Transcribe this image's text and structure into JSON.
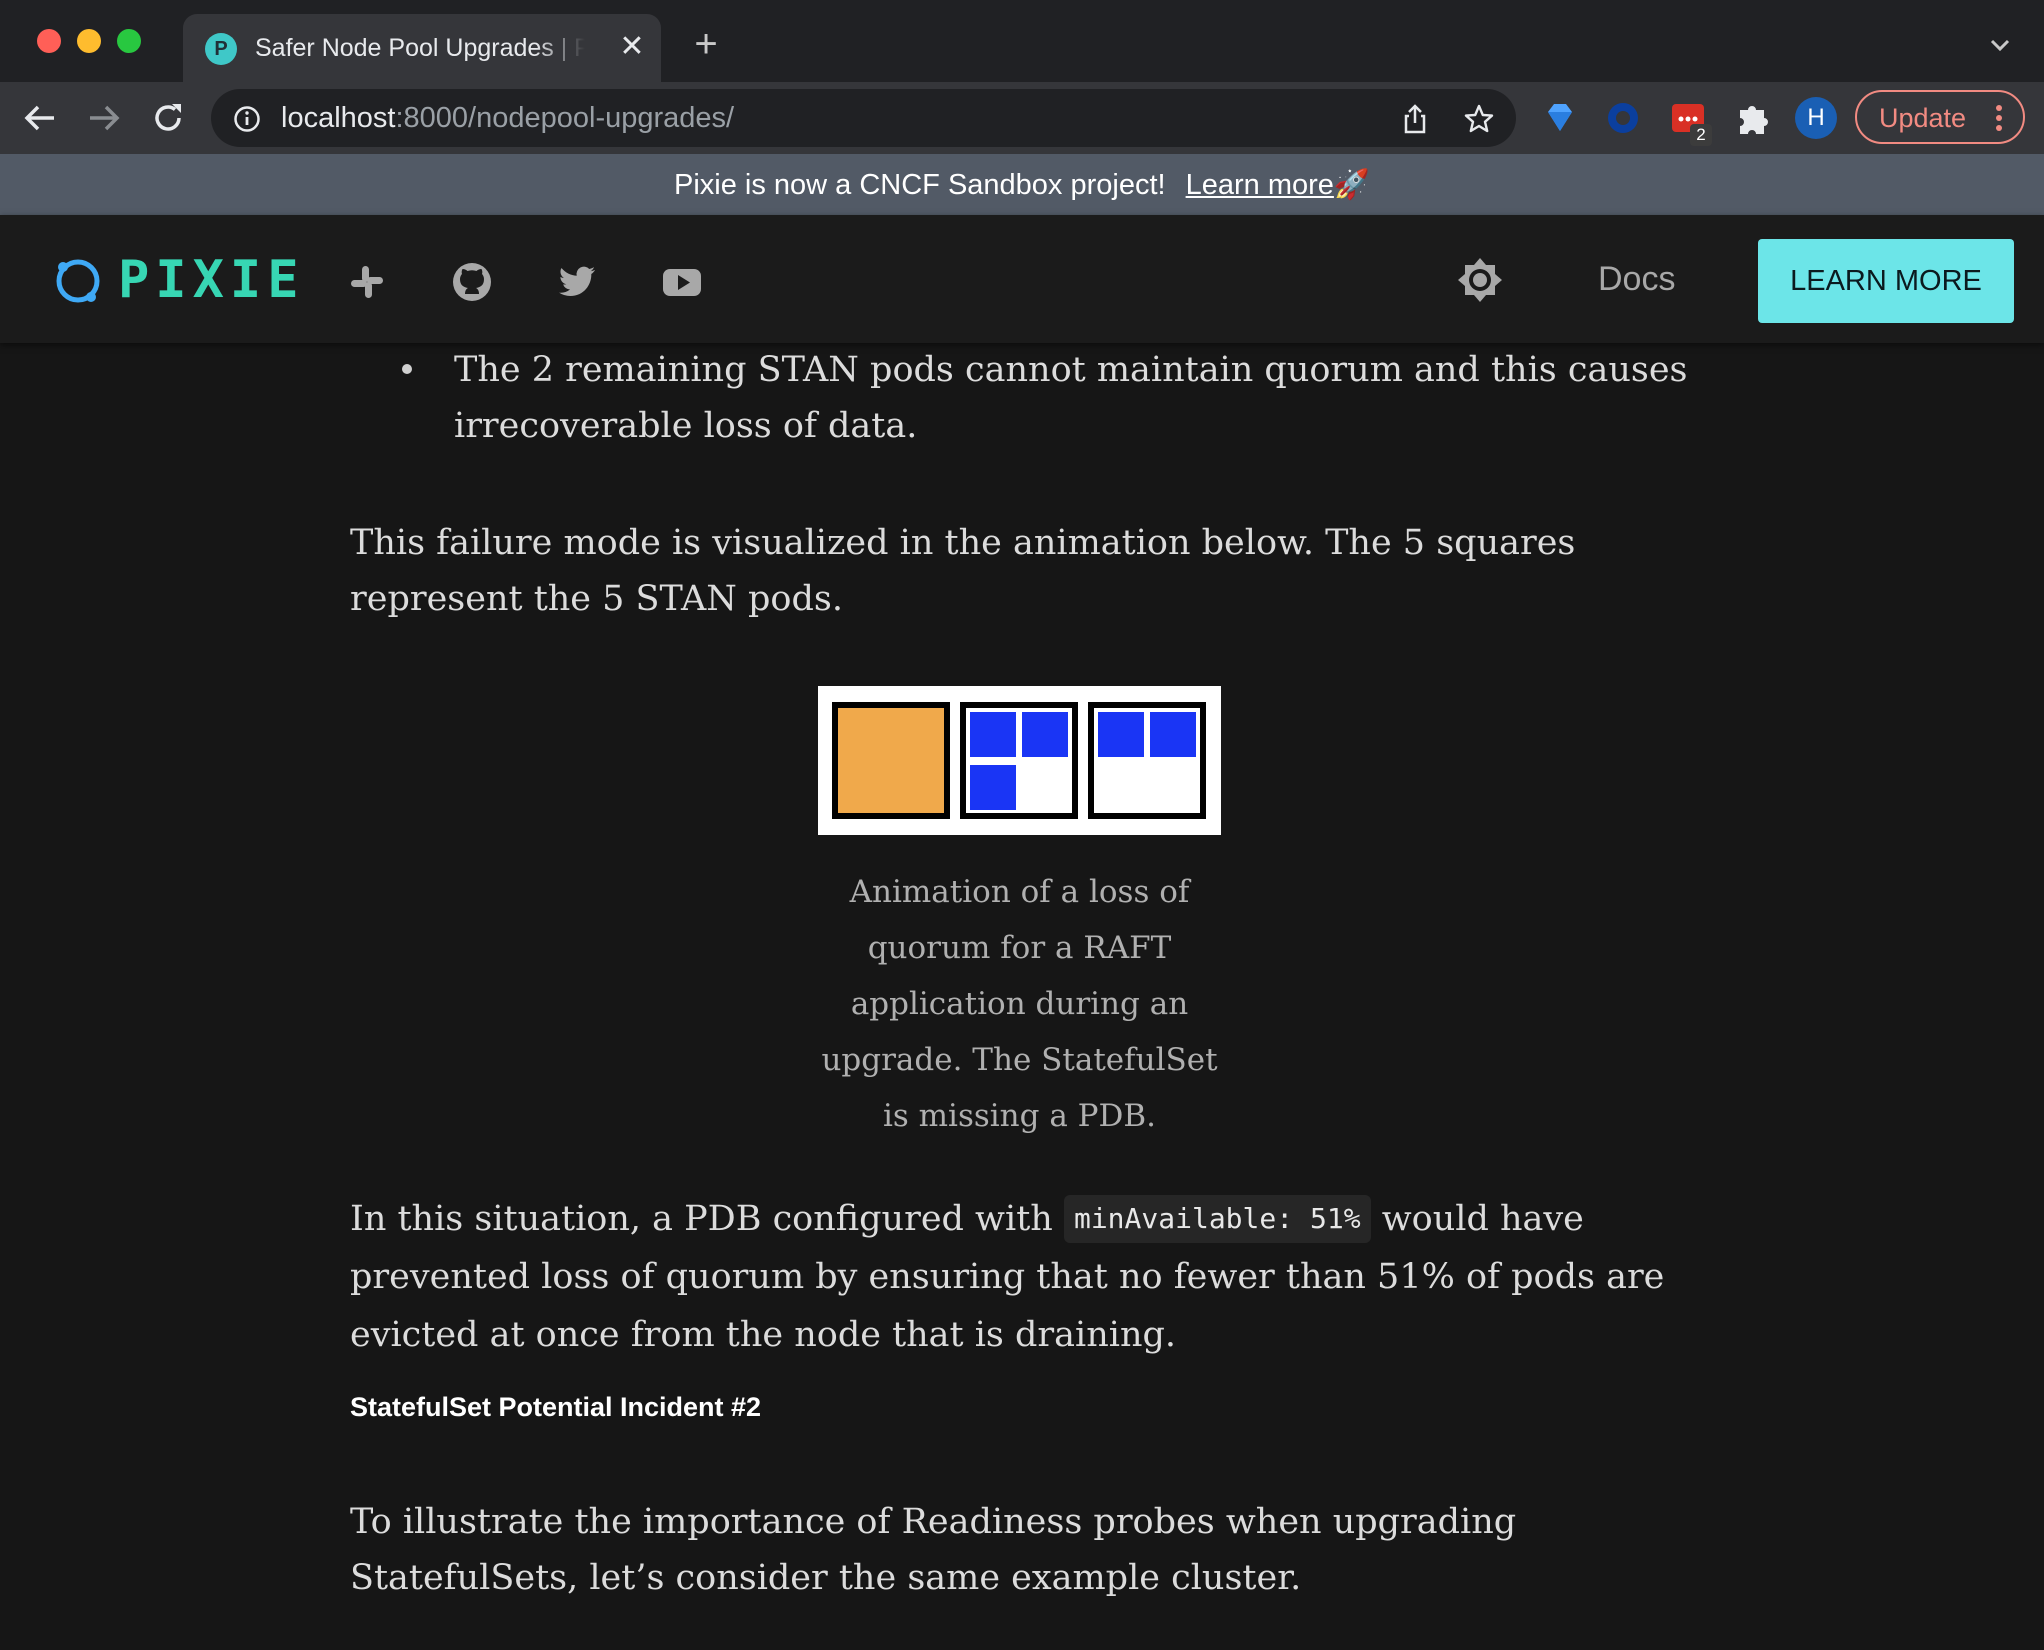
{
  "browser": {
    "tab_title": "Safer Node Pool Upgrades | Pixie",
    "tab_favicon_letter": "P",
    "close_glyph": "✕",
    "new_tab_glyph": "+",
    "url_host": "localhost",
    "url_rest": ":8000/nodepool-upgrades/",
    "extension_badge": "2",
    "avatar_letter": "H",
    "update_label": "Update"
  },
  "banner": {
    "text": "Pixie is now a CNCF Sandbox project!",
    "link": "Learn more",
    "emoji": "🚀"
  },
  "header": {
    "logo_text": "PIXIE",
    "docs_label": "Docs",
    "cta_label": "LEARN MORE",
    "accent_color": "#37d6b3",
    "cta_color": "#6ce5e8"
  },
  "article": {
    "bullet": "The 2 remaining STAN pods cannot maintain quorum and this causes irrecoverable loss of data.",
    "para1": "This failure mode is visualized in the animation below. The 5 squares represent the 5 STAN pods.",
    "caption": "Animation of a loss of quorum for a RAFT application during an upgrade. The StatefulSet is missing a PDB.",
    "para2_before": "In this situation, a PDB configured with",
    "para2_code": "minAvailable: 51%",
    "para2_after": "would have prevented loss of quorum by ensuring that no fewer than 51% of pods are evicted at once from the node that is draining.",
    "subheading": "StatefulSet Potential Incident #2",
    "para3": "To illustrate the importance of Readiness probes when upgrading StatefulSets, let’s consider the same example cluster."
  },
  "figure": {
    "pod_color": "#1a35f5",
    "draining_node_color": "#f0a94b"
  }
}
